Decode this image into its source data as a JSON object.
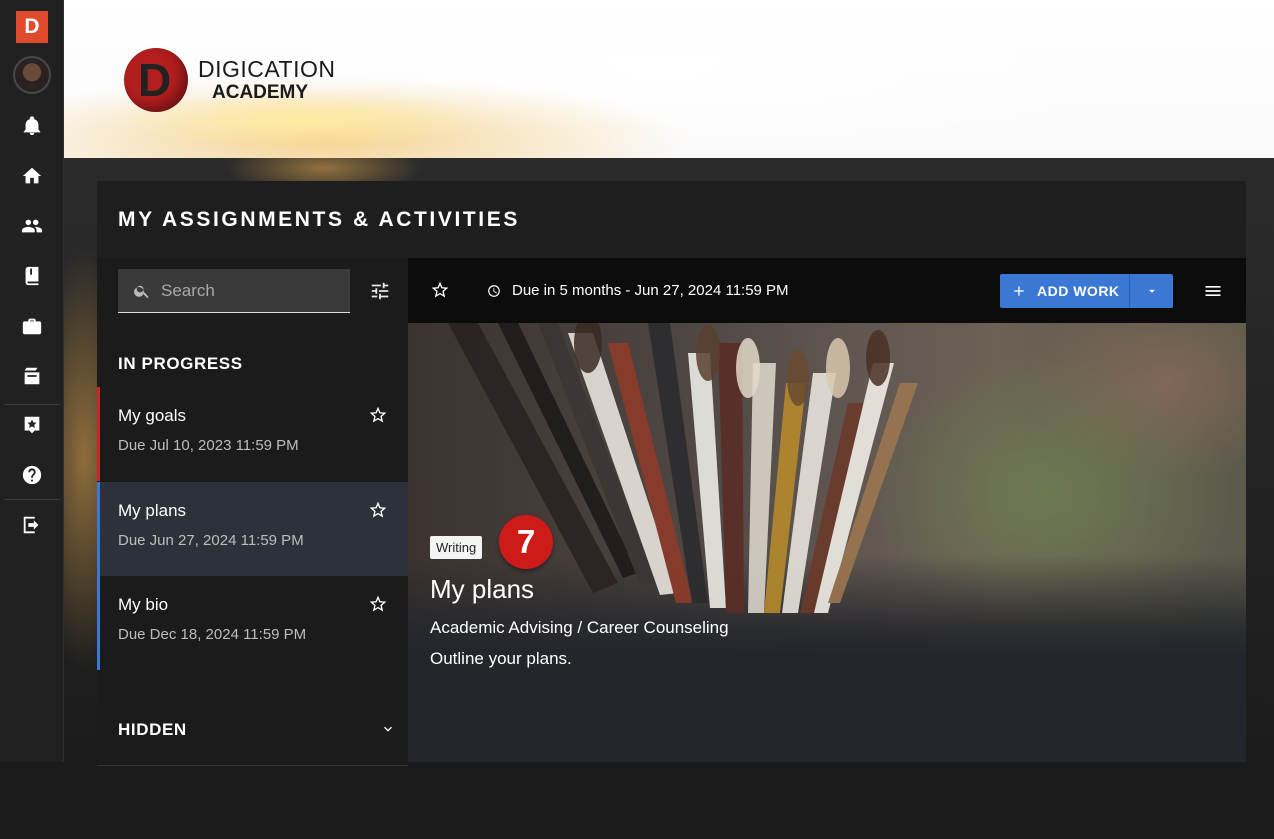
{
  "rail": {
    "logo_letter": "D",
    "icons": [
      "bell-icon",
      "home-icon",
      "people-icon",
      "book-icon",
      "briefcase-icon",
      "stack-icon",
      "star-add-icon",
      "help-icon",
      "exit-icon"
    ]
  },
  "brand": {
    "letter": "D",
    "line1": "DIGICATION",
    "line2": "ACADEMY"
  },
  "card": {
    "title": "MY ASSIGNMENTS & ACTIVITIES"
  },
  "search": {
    "placeholder": "Search"
  },
  "sections": {
    "in_progress": "IN PROGRESS",
    "hidden": "HIDDEN"
  },
  "items": [
    {
      "title": "My goals",
      "due": "Due Jul 10, 2023 11:59 PM",
      "accent": "#c62828",
      "selected": false
    },
    {
      "title": "My plans",
      "due": "Due Jun 27, 2024 11:59 PM",
      "accent": "#3a78d6",
      "selected": true
    },
    {
      "title": "My bio",
      "due": "Due Dec 18, 2024 11:59 PM",
      "accent": "#3a78d6",
      "selected": false
    }
  ],
  "toolbar": {
    "due_text": "Due in 5 months - Jun 27, 2024 11:59 PM",
    "add_work": "ADD WORK"
  },
  "detail": {
    "tag": "Writing",
    "badge_count": "7",
    "title": "My plans",
    "course": "Academic Advising / Career Counseling",
    "description": "Outline your plans."
  },
  "colors": {
    "accent_blue": "#3a78d6",
    "brand_red": "#e04a2d",
    "badge_red": "#cf1a1a"
  }
}
